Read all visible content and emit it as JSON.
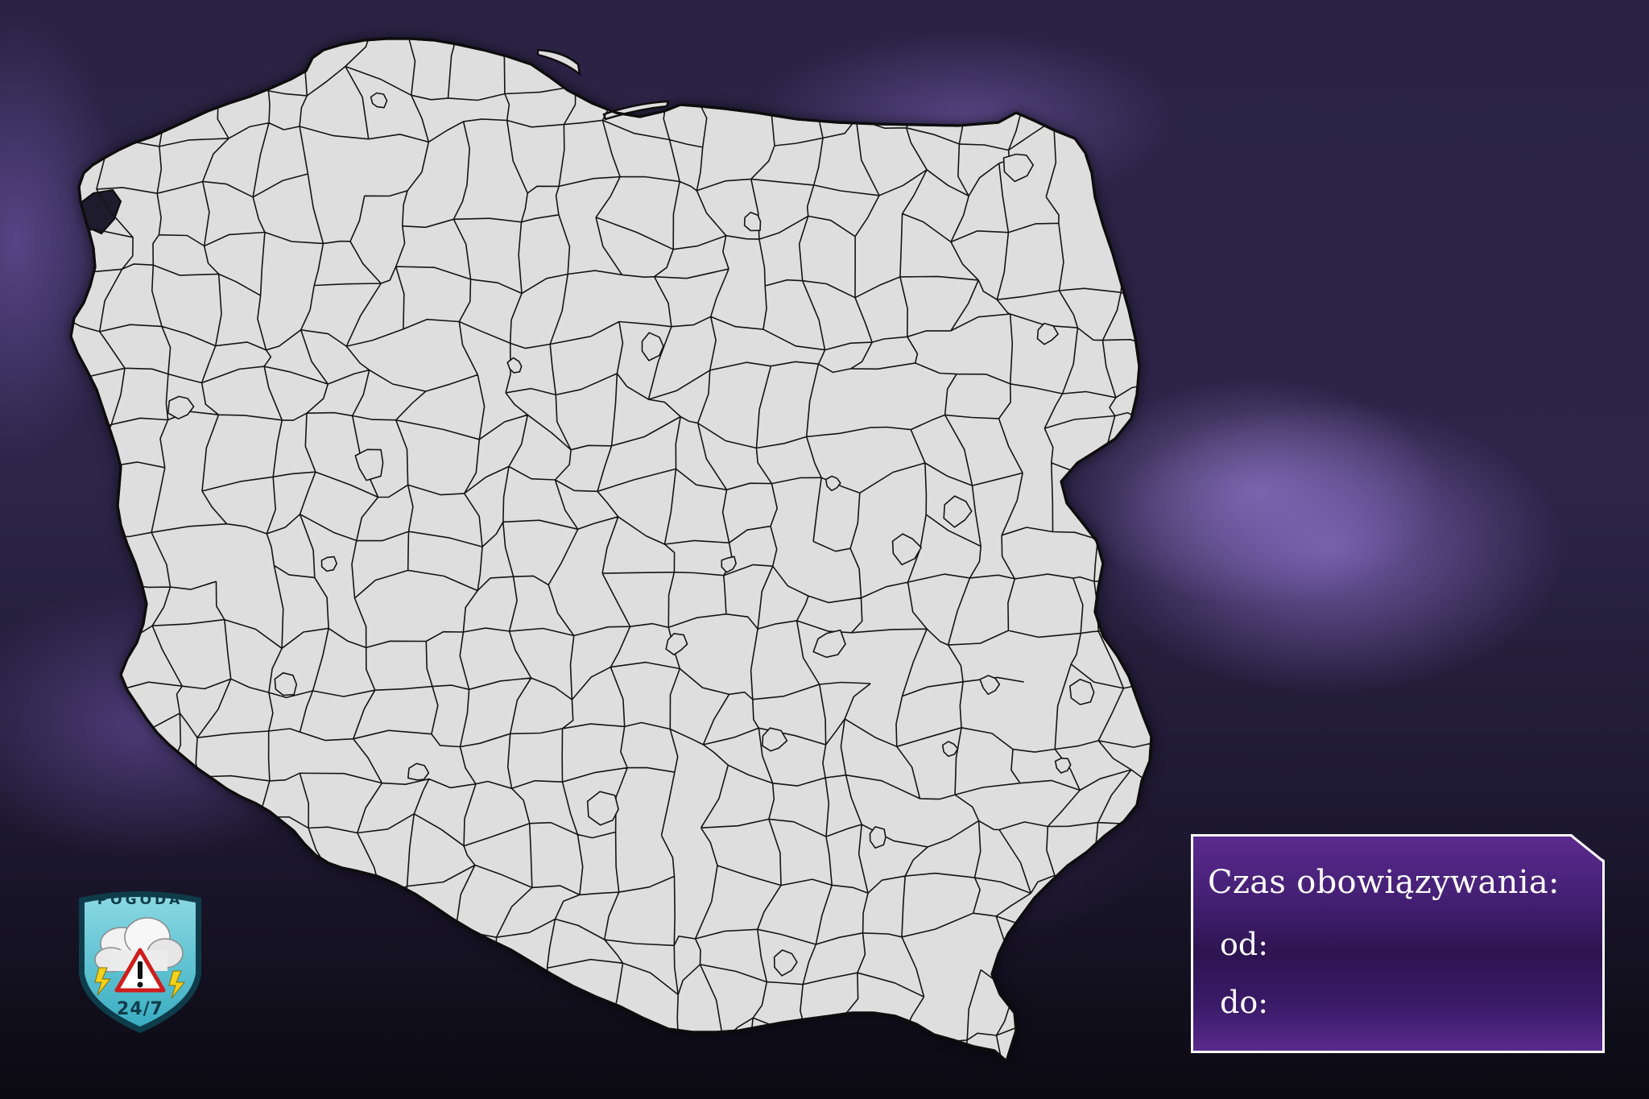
{
  "map": {
    "fill_color": "#dedede",
    "stroke_color": "#141414"
  },
  "info_box": {
    "title": "Czas obowiązywania:",
    "from_label": "od:",
    "to_label": "do:",
    "accent_color": "#4a2378"
  },
  "logo": {
    "top_text": "POGODA",
    "bottom_text": "24/7",
    "icons": [
      "cloud-icon",
      "warning-triangle-icon",
      "lightning-icon"
    ],
    "badge_color": "#5cc3d3"
  }
}
